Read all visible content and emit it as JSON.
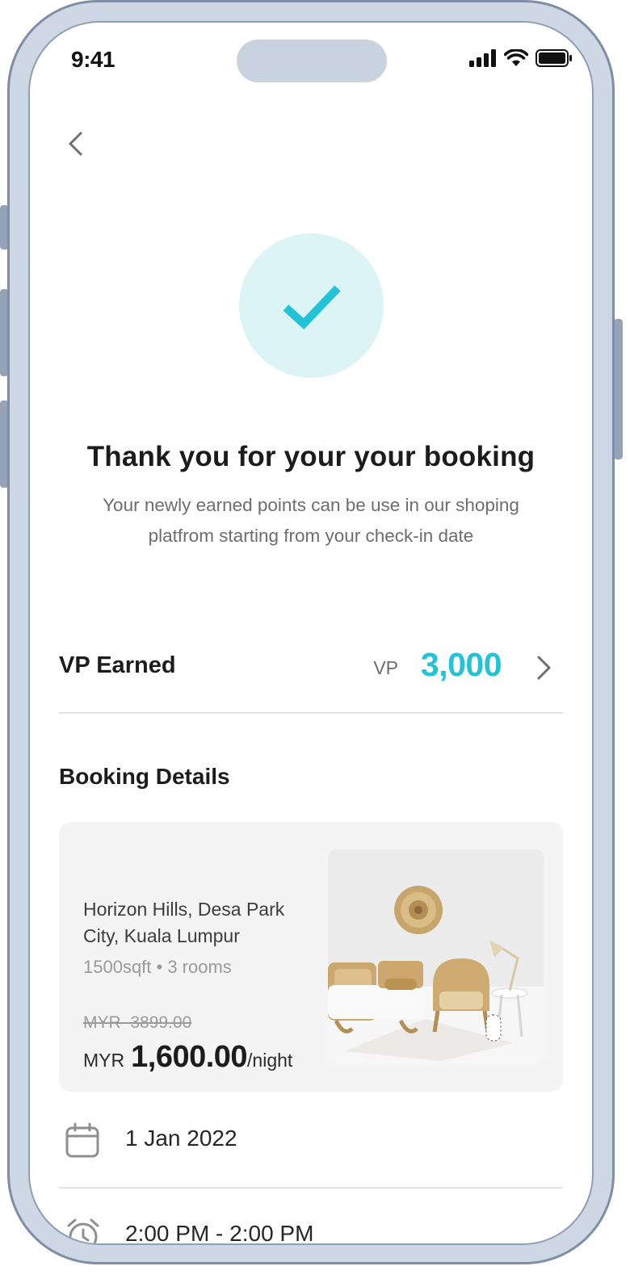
{
  "status_bar": {
    "time": "9:41"
  },
  "nav": {
    "back_icon": "chevron-left-icon"
  },
  "confirmation": {
    "icon": "checkmark-icon",
    "title": "Thank you for your your booking",
    "subtitle": "Your newly earned points can be use in our shoping platfrom starting from your check-in date"
  },
  "points": {
    "label": "VP Earned",
    "unit": "VP",
    "value": "3,000"
  },
  "booking": {
    "section_title": "Booking Details",
    "address": "Horizon Hills, Desa Park City, Kuala Lumpur",
    "meta": "1500sqft • 3 rooms",
    "original_price": "MYR  3899.00",
    "currency": "MYR",
    "price": "1,600.00",
    "price_unit": "/night",
    "date": "1 Jan 2022",
    "time": "2:00 PM - 2:00 PM"
  },
  "colors": {
    "accent": "#22c3d6",
    "accent_light": "#dcf4f6",
    "frame": "#ced8e4",
    "card_bg": "#f4f4f4"
  }
}
